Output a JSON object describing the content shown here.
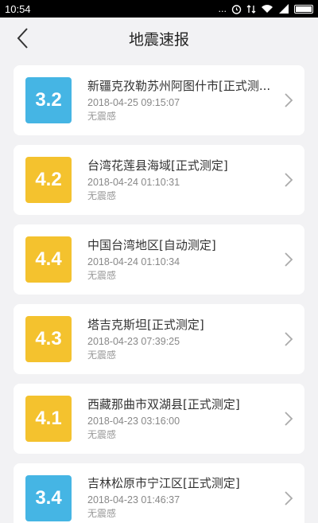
{
  "status_bar": {
    "time": "10:54",
    "signal_text": "..."
  },
  "header": {
    "title": "地震速报"
  },
  "colors": {
    "blue": "#45b5e4",
    "yellow": "#f4c22e"
  },
  "items": [
    {
      "magnitude": "3.2",
      "color": "blue",
      "place": "新疆克孜勒苏州阿图什市[正式测...",
      "time": "2018-04-25 09:15:07",
      "feel": "无震感"
    },
    {
      "magnitude": "4.2",
      "color": "yellow",
      "place": "台湾花莲县海域[正式测定]",
      "time": "2018-04-24 01:10:31",
      "feel": "无震感"
    },
    {
      "magnitude": "4.4",
      "color": "yellow",
      "place": "中国台湾地区[自动测定]",
      "time": "2018-04-24 01:10:34",
      "feel": "无震感"
    },
    {
      "magnitude": "4.3",
      "color": "yellow",
      "place": "塔吉克斯坦[正式测定]",
      "time": "2018-04-23 07:39:25",
      "feel": "无震感"
    },
    {
      "magnitude": "4.1",
      "color": "yellow",
      "place": "西藏那曲市双湖县[正式测定]",
      "time": "2018-04-23 03:16:00",
      "feel": "无震感"
    },
    {
      "magnitude": "3.4",
      "color": "blue",
      "place": "吉林松原市宁江区[正式测定]",
      "time": "2018-04-23 01:46:37",
      "feel": "无震感"
    }
  ]
}
